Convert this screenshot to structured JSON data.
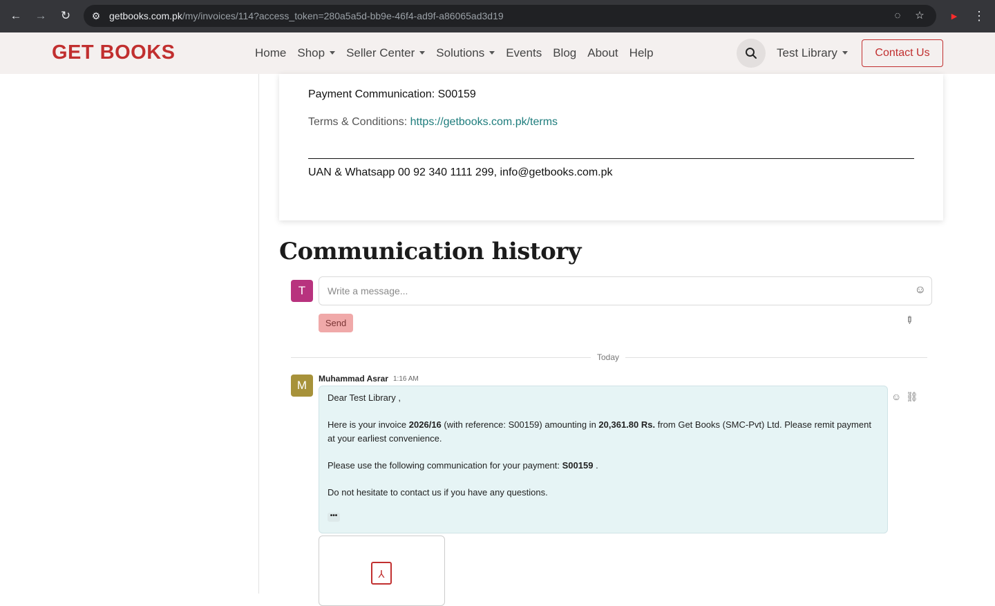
{
  "browser": {
    "url_host": "getbooks.com.pk",
    "url_path": "/my/invoices/114?access_token=280a5a5d-bb9e-46f4-ad9f-a86065ad3d19"
  },
  "header": {
    "brand": "GET BOOKS",
    "nav": [
      "Home",
      "Shop",
      "Seller Center",
      "Solutions",
      "Events",
      "Blog",
      "About",
      "Help"
    ],
    "user": "Test Library",
    "contact": "Contact Us",
    "brand_color": "#c12f2f"
  },
  "invoice": {
    "payment_comm": "Payment Communication: S00159",
    "terms_label": "Terms & Conditions:",
    "terms_link": "https://getbooks.com.pk/terms",
    "footer": "UAN & Whatsapp 00 92 340 1111 299, info@getbooks.com.pk"
  },
  "comm": {
    "title": "Communication history",
    "composer_avatar": "T",
    "placeholder": "Write a message...",
    "send": "Send",
    "separator": "Today",
    "message": {
      "avatar": "M",
      "author": "Muhammad Asrar",
      "time": "1:16 AM",
      "greeting": "Dear Test Library ,",
      "p1_a": "Here is your invoice ",
      "p1_invoice": "2026/16",
      "p1_b": " (with reference: S00159) amounting in ",
      "p1_amount": "20,361.80 Rs.",
      "p1_c": " from Get Books (SMC-Pvt) Ltd. Please remit payment at your earliest convenience.",
      "p2_a": "Please use the following communication for your payment: ",
      "p2_code": "S00159",
      "p2_b": " .",
      "p3": "Do not hesitate to contact us if you have any questions.",
      "more": "•••"
    }
  }
}
